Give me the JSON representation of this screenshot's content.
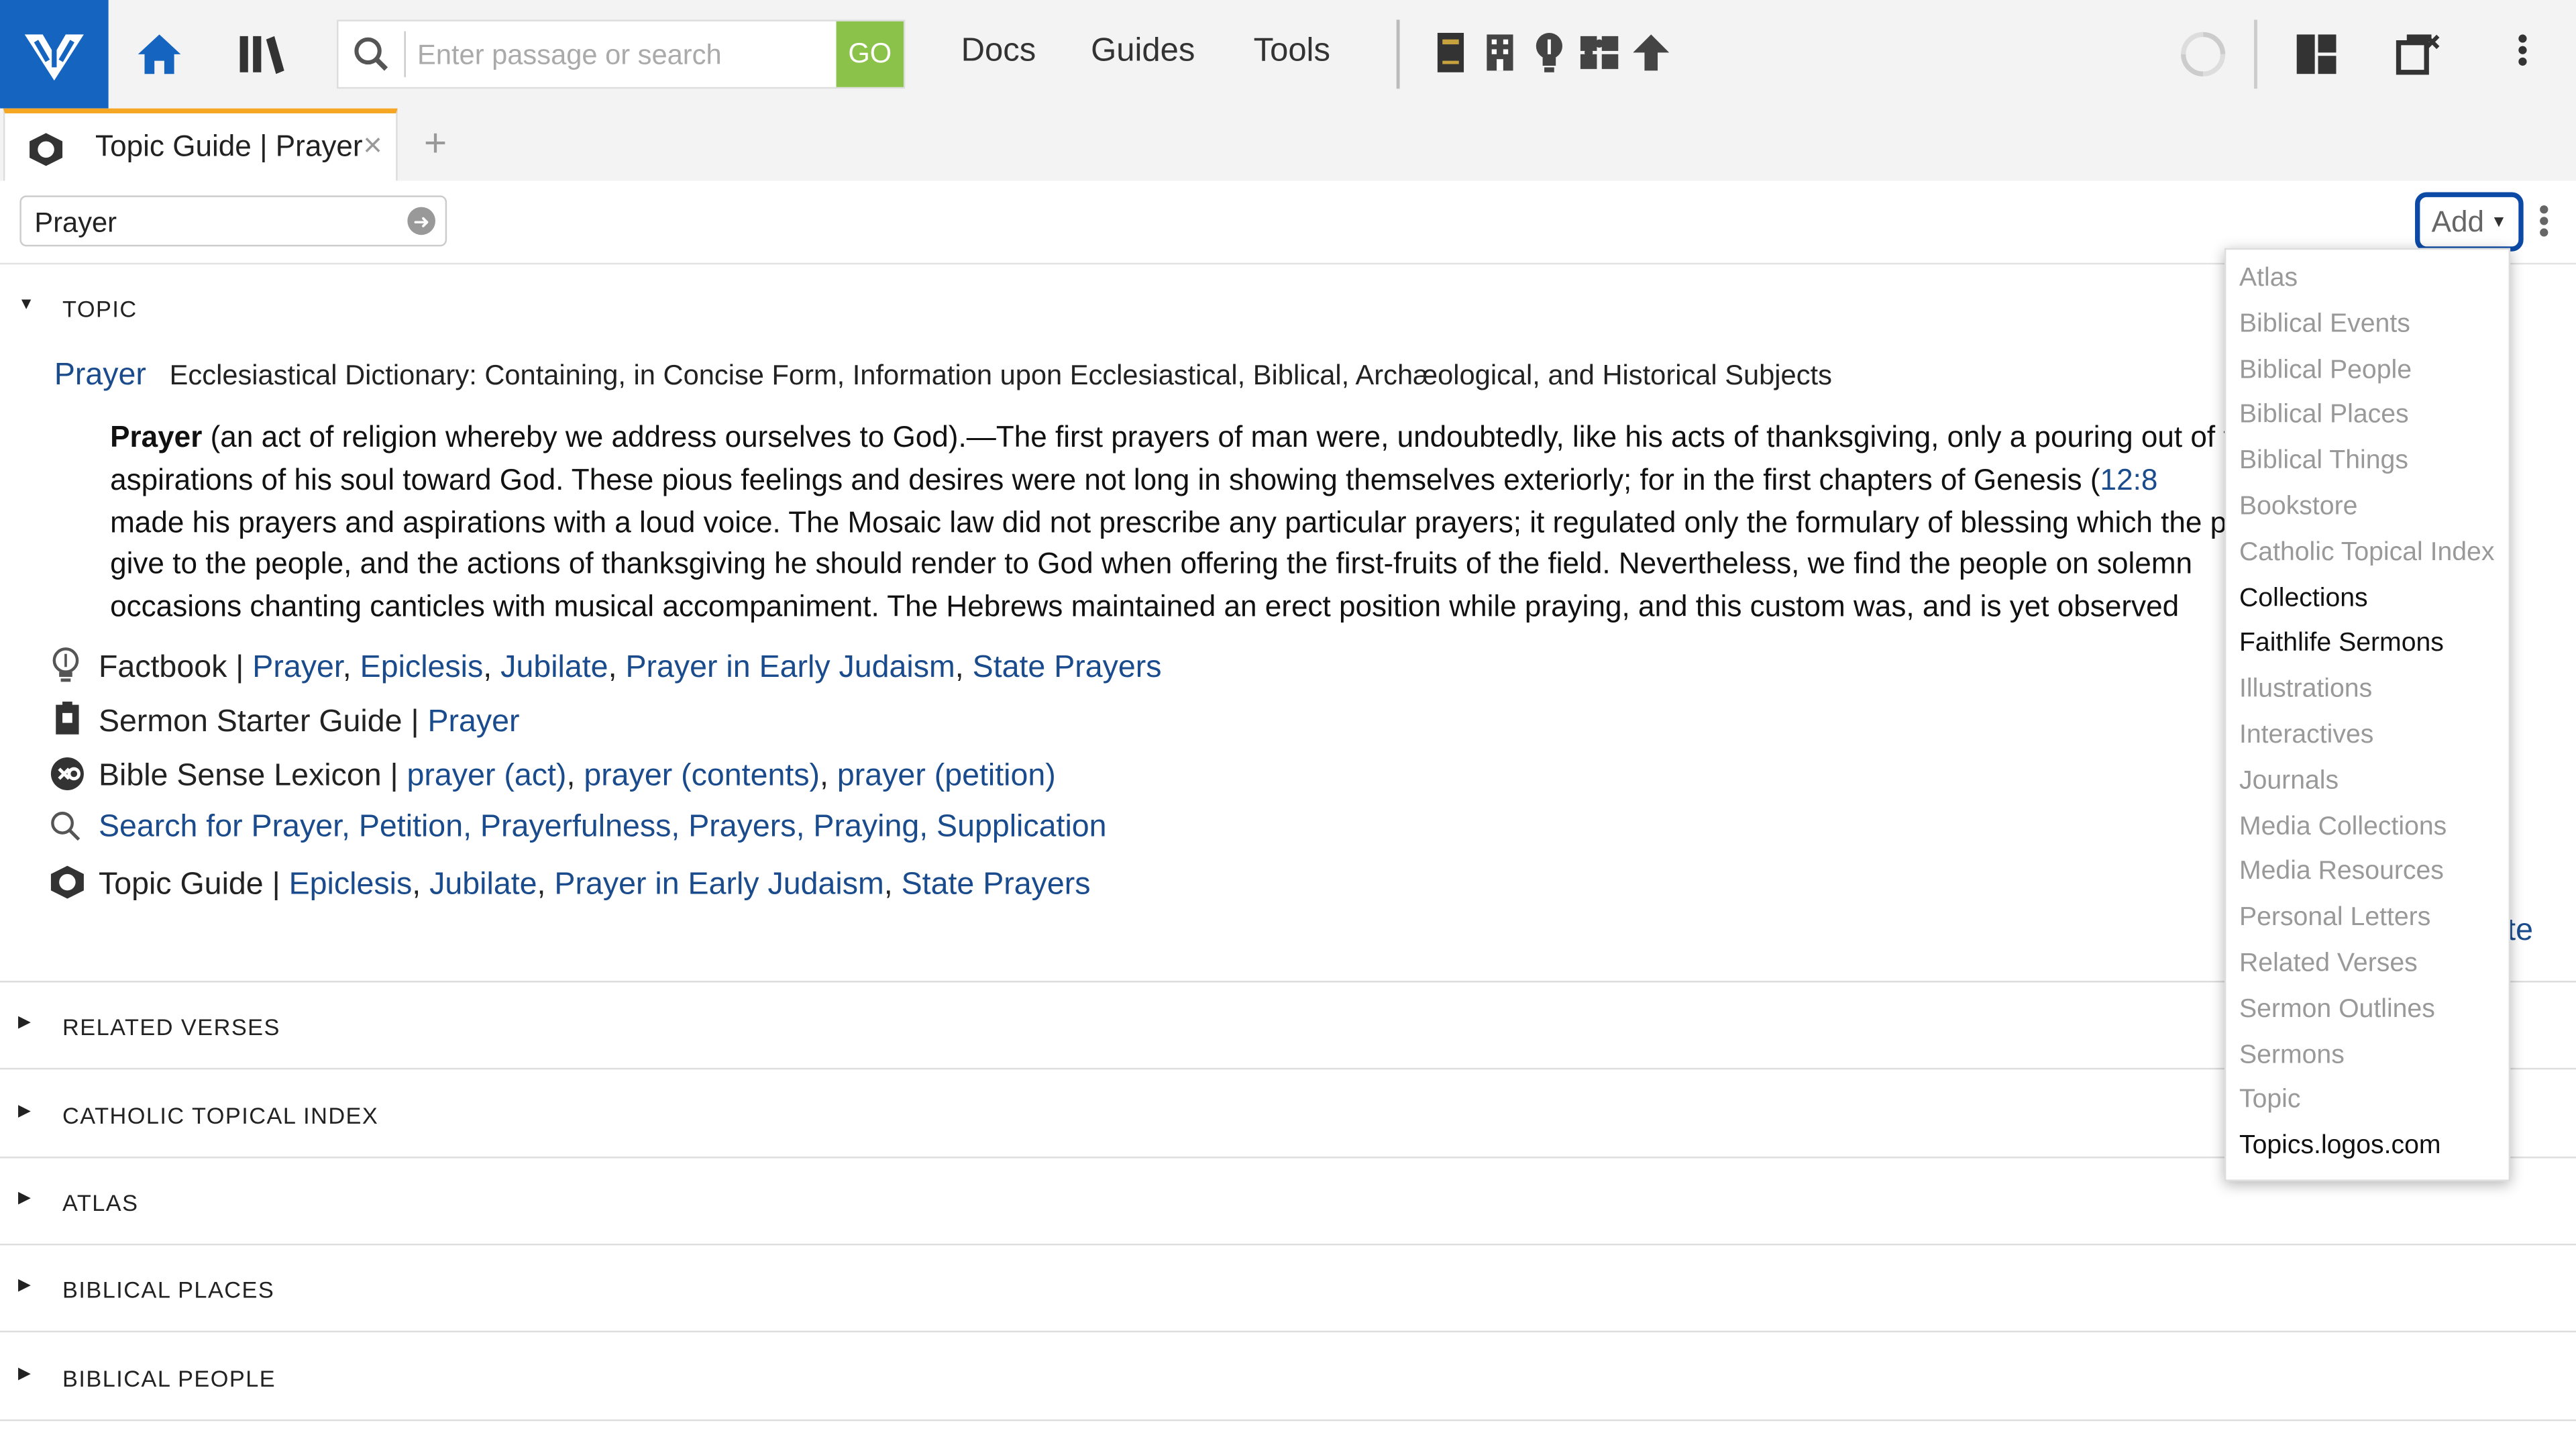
{
  "toolbar": {
    "search_placeholder": "Enter passage or search",
    "go_label": "GO",
    "menu": [
      "Docs",
      "Guides",
      "Tools"
    ],
    "icons": [
      "logos-logo-icon",
      "home-icon",
      "library-icon",
      "book-icon",
      "building-icon",
      "lightbulb-icon",
      "puzzle-icon",
      "upload-icon",
      "sync-icon",
      "layout-icon",
      "close-all-panels-icon",
      "more-vertical-icon"
    ],
    "accent": "#1565c0",
    "go_color": "#8bc34a"
  },
  "tabs": {
    "active_title": "Topic Guide | Prayer",
    "close_glyph": "×",
    "add_glyph": "+"
  },
  "panel": {
    "topic_value": "Prayer",
    "add_label": "Add"
  },
  "topic_section": {
    "label": "TOPIC",
    "entry_title": "Prayer",
    "entry_source": "Ecclesiastical Dictionary: Containing, in Concise Form, Information upon Ecclesiastical, Biblical, Archæological, and Historical Subjects",
    "article": {
      "lead": "Prayer",
      "line1": " (an act of religion whereby we address ourselves to God).—The first prayers of man were, undoubtedly, like his acts of thanksgiving, only a pouring out of the",
      "line2a": "aspirations of his soul toward God. These pious feelings and desires were not long in showing themselves exteriorly; for in the first chapters of Genesis (",
      "line2_ref": "12:8",
      "line3": "made his prayers and aspirations with a loud voice. The Mosaic law did not prescribe any particular prayers; it regulated only the formulary of blessing which the priest should",
      "line4": "give to the people, and the actions of thanksgiving he should render to God when offering the first-fruits of the field. Nevertheless, we find the people on solemn",
      "line5": "occasions chanting canticles with musical accompaniment. The Hebrews maintained an erect position while praying, and this custom was, and is yet observed"
    },
    "resources": [
      {
        "source": "Factbook",
        "links": [
          "Prayer",
          "Epiclesis",
          "Jubilate",
          "Prayer in Early Judaism",
          "State Prayers"
        ]
      },
      {
        "source": "Sermon Starter Guide",
        "links": [
          "Prayer"
        ]
      },
      {
        "source": "Bible Sense Lexicon",
        "links": [
          "prayer (act)",
          "prayer (contents)",
          "prayer (petition)"
        ]
      },
      {
        "source": "",
        "search_text": "Search for Prayer, Petition, Prayerfulness, Prayers, Praying, Supplication"
      },
      {
        "source": "Topic Guide",
        "links": [
          "Epiclesis",
          "Jubilate",
          "Prayer in Early Judaism",
          "State Prayers"
        ]
      }
    ],
    "partial_link": "te",
    "separator": " | ",
    "comma": ", "
  },
  "sections": [
    "RELATED VERSES",
    "CATHOLIC TOPICAL INDEX",
    "ATLAS",
    "BIBLICAL PLACES",
    "BIBLICAL PEOPLE"
  ],
  "add_menu": {
    "items": [
      {
        "label": "Atlas",
        "enabled": false
      },
      {
        "label": "Biblical Events",
        "enabled": false
      },
      {
        "label": "Biblical People",
        "enabled": false
      },
      {
        "label": "Biblical Places",
        "enabled": false
      },
      {
        "label": "Biblical Things",
        "enabled": false
      },
      {
        "label": "Bookstore",
        "enabled": false
      },
      {
        "label": "Catholic Topical Index",
        "enabled": false
      },
      {
        "label": "Collections",
        "enabled": true
      },
      {
        "label": "Faithlife Sermons",
        "enabled": true
      },
      {
        "label": "Illustrations",
        "enabled": false
      },
      {
        "label": "Interactives",
        "enabled": false
      },
      {
        "label": "Journals",
        "enabled": false
      },
      {
        "label": "Media Collections",
        "enabled": false
      },
      {
        "label": "Media Resources",
        "enabled": false
      },
      {
        "label": "Personal Letters",
        "enabled": false
      },
      {
        "label": "Related Verses",
        "enabled": false
      },
      {
        "label": "Sermon Outlines",
        "enabled": false
      },
      {
        "label": "Sermons",
        "enabled": false
      },
      {
        "label": "Topic",
        "enabled": false
      },
      {
        "label": "Topics.logos.com",
        "enabled": true
      }
    ]
  }
}
